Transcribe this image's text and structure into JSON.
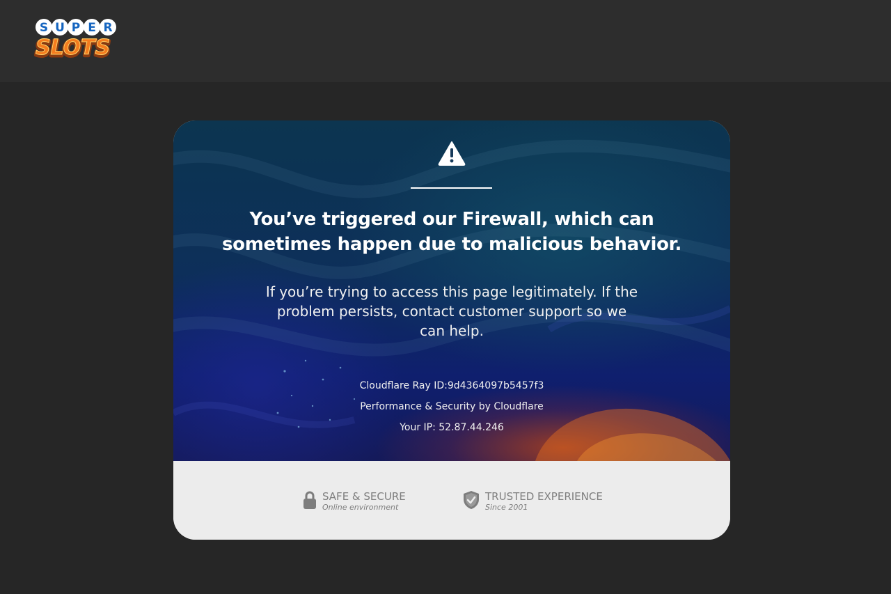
{
  "brand": {
    "logo_top": "SUPER",
    "logo_bottom": "SLOTS",
    "colors": {
      "page_bg": "#262626",
      "topbar_bg": "#2d2d2d",
      "logo_blue": "#1565c0",
      "logo_orange": "#f57c1f",
      "card_footer_bg": "#ececec",
      "footer_text": "#7d7d7d"
    }
  },
  "card": {
    "icon": "warning-triangle-icon",
    "headline": "You’ve triggered our Firewall, which can sometimes happen due to malicious behavior.",
    "subtext": "If you’re trying to access this page legitimately. If the problem persists, contact customer support so we can help.",
    "ray_id": "Cloudflare Ray ID:9d4364097b5457f3",
    "performance": "Performance & Security by Cloudflare",
    "ip": "Your IP: 52.87.44.246"
  },
  "footer": {
    "badges": [
      {
        "icon": "padlock-icon",
        "title": "SAFE & SECURE",
        "subtitle": "Online environment"
      },
      {
        "icon": "shield-check-icon",
        "title": "TRUSTED EXPERIENCE",
        "subtitle": "Since 2001"
      }
    ]
  }
}
